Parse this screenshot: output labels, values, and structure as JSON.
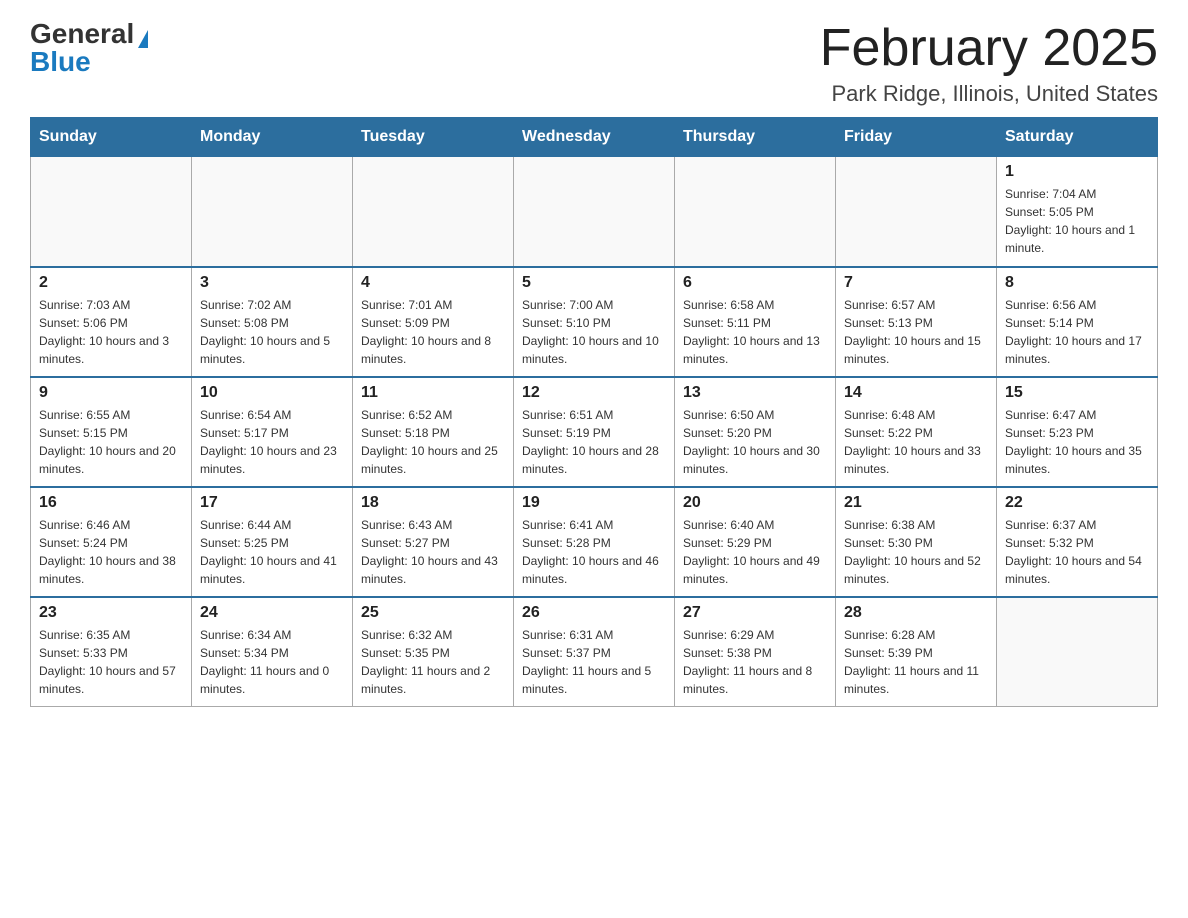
{
  "logo": {
    "general": "General",
    "blue": "Blue"
  },
  "title": {
    "month_year": "February 2025",
    "location": "Park Ridge, Illinois, United States"
  },
  "weekdays": [
    "Sunday",
    "Monday",
    "Tuesday",
    "Wednesday",
    "Thursday",
    "Friday",
    "Saturday"
  ],
  "weeks": [
    [
      {
        "day": "",
        "sunrise": "",
        "sunset": "",
        "daylight": ""
      },
      {
        "day": "",
        "sunrise": "",
        "sunset": "",
        "daylight": ""
      },
      {
        "day": "",
        "sunrise": "",
        "sunset": "",
        "daylight": ""
      },
      {
        "day": "",
        "sunrise": "",
        "sunset": "",
        "daylight": ""
      },
      {
        "day": "",
        "sunrise": "",
        "sunset": "",
        "daylight": ""
      },
      {
        "day": "",
        "sunrise": "",
        "sunset": "",
        "daylight": ""
      },
      {
        "day": "1",
        "sunrise": "Sunrise: 7:04 AM",
        "sunset": "Sunset: 5:05 PM",
        "daylight": "Daylight: 10 hours and 1 minute."
      }
    ],
    [
      {
        "day": "2",
        "sunrise": "Sunrise: 7:03 AM",
        "sunset": "Sunset: 5:06 PM",
        "daylight": "Daylight: 10 hours and 3 minutes."
      },
      {
        "day": "3",
        "sunrise": "Sunrise: 7:02 AM",
        "sunset": "Sunset: 5:08 PM",
        "daylight": "Daylight: 10 hours and 5 minutes."
      },
      {
        "day": "4",
        "sunrise": "Sunrise: 7:01 AM",
        "sunset": "Sunset: 5:09 PM",
        "daylight": "Daylight: 10 hours and 8 minutes."
      },
      {
        "day": "5",
        "sunrise": "Sunrise: 7:00 AM",
        "sunset": "Sunset: 5:10 PM",
        "daylight": "Daylight: 10 hours and 10 minutes."
      },
      {
        "day": "6",
        "sunrise": "Sunrise: 6:58 AM",
        "sunset": "Sunset: 5:11 PM",
        "daylight": "Daylight: 10 hours and 13 minutes."
      },
      {
        "day": "7",
        "sunrise": "Sunrise: 6:57 AM",
        "sunset": "Sunset: 5:13 PM",
        "daylight": "Daylight: 10 hours and 15 minutes."
      },
      {
        "day": "8",
        "sunrise": "Sunrise: 6:56 AM",
        "sunset": "Sunset: 5:14 PM",
        "daylight": "Daylight: 10 hours and 17 minutes."
      }
    ],
    [
      {
        "day": "9",
        "sunrise": "Sunrise: 6:55 AM",
        "sunset": "Sunset: 5:15 PM",
        "daylight": "Daylight: 10 hours and 20 minutes."
      },
      {
        "day": "10",
        "sunrise": "Sunrise: 6:54 AM",
        "sunset": "Sunset: 5:17 PM",
        "daylight": "Daylight: 10 hours and 23 minutes."
      },
      {
        "day": "11",
        "sunrise": "Sunrise: 6:52 AM",
        "sunset": "Sunset: 5:18 PM",
        "daylight": "Daylight: 10 hours and 25 minutes."
      },
      {
        "day": "12",
        "sunrise": "Sunrise: 6:51 AM",
        "sunset": "Sunset: 5:19 PM",
        "daylight": "Daylight: 10 hours and 28 minutes."
      },
      {
        "day": "13",
        "sunrise": "Sunrise: 6:50 AM",
        "sunset": "Sunset: 5:20 PM",
        "daylight": "Daylight: 10 hours and 30 minutes."
      },
      {
        "day": "14",
        "sunrise": "Sunrise: 6:48 AM",
        "sunset": "Sunset: 5:22 PM",
        "daylight": "Daylight: 10 hours and 33 minutes."
      },
      {
        "day": "15",
        "sunrise": "Sunrise: 6:47 AM",
        "sunset": "Sunset: 5:23 PM",
        "daylight": "Daylight: 10 hours and 35 minutes."
      }
    ],
    [
      {
        "day": "16",
        "sunrise": "Sunrise: 6:46 AM",
        "sunset": "Sunset: 5:24 PM",
        "daylight": "Daylight: 10 hours and 38 minutes."
      },
      {
        "day": "17",
        "sunrise": "Sunrise: 6:44 AM",
        "sunset": "Sunset: 5:25 PM",
        "daylight": "Daylight: 10 hours and 41 minutes."
      },
      {
        "day": "18",
        "sunrise": "Sunrise: 6:43 AM",
        "sunset": "Sunset: 5:27 PM",
        "daylight": "Daylight: 10 hours and 43 minutes."
      },
      {
        "day": "19",
        "sunrise": "Sunrise: 6:41 AM",
        "sunset": "Sunset: 5:28 PM",
        "daylight": "Daylight: 10 hours and 46 minutes."
      },
      {
        "day": "20",
        "sunrise": "Sunrise: 6:40 AM",
        "sunset": "Sunset: 5:29 PM",
        "daylight": "Daylight: 10 hours and 49 minutes."
      },
      {
        "day": "21",
        "sunrise": "Sunrise: 6:38 AM",
        "sunset": "Sunset: 5:30 PM",
        "daylight": "Daylight: 10 hours and 52 minutes."
      },
      {
        "day": "22",
        "sunrise": "Sunrise: 6:37 AM",
        "sunset": "Sunset: 5:32 PM",
        "daylight": "Daylight: 10 hours and 54 minutes."
      }
    ],
    [
      {
        "day": "23",
        "sunrise": "Sunrise: 6:35 AM",
        "sunset": "Sunset: 5:33 PM",
        "daylight": "Daylight: 10 hours and 57 minutes."
      },
      {
        "day": "24",
        "sunrise": "Sunrise: 6:34 AM",
        "sunset": "Sunset: 5:34 PM",
        "daylight": "Daylight: 11 hours and 0 minutes."
      },
      {
        "day": "25",
        "sunrise": "Sunrise: 6:32 AM",
        "sunset": "Sunset: 5:35 PM",
        "daylight": "Daylight: 11 hours and 2 minutes."
      },
      {
        "day": "26",
        "sunrise": "Sunrise: 6:31 AM",
        "sunset": "Sunset: 5:37 PM",
        "daylight": "Daylight: 11 hours and 5 minutes."
      },
      {
        "day": "27",
        "sunrise": "Sunrise: 6:29 AM",
        "sunset": "Sunset: 5:38 PM",
        "daylight": "Daylight: 11 hours and 8 minutes."
      },
      {
        "day": "28",
        "sunrise": "Sunrise: 6:28 AM",
        "sunset": "Sunset: 5:39 PM",
        "daylight": "Daylight: 11 hours and 11 minutes."
      },
      {
        "day": "",
        "sunrise": "",
        "sunset": "",
        "daylight": ""
      }
    ]
  ]
}
